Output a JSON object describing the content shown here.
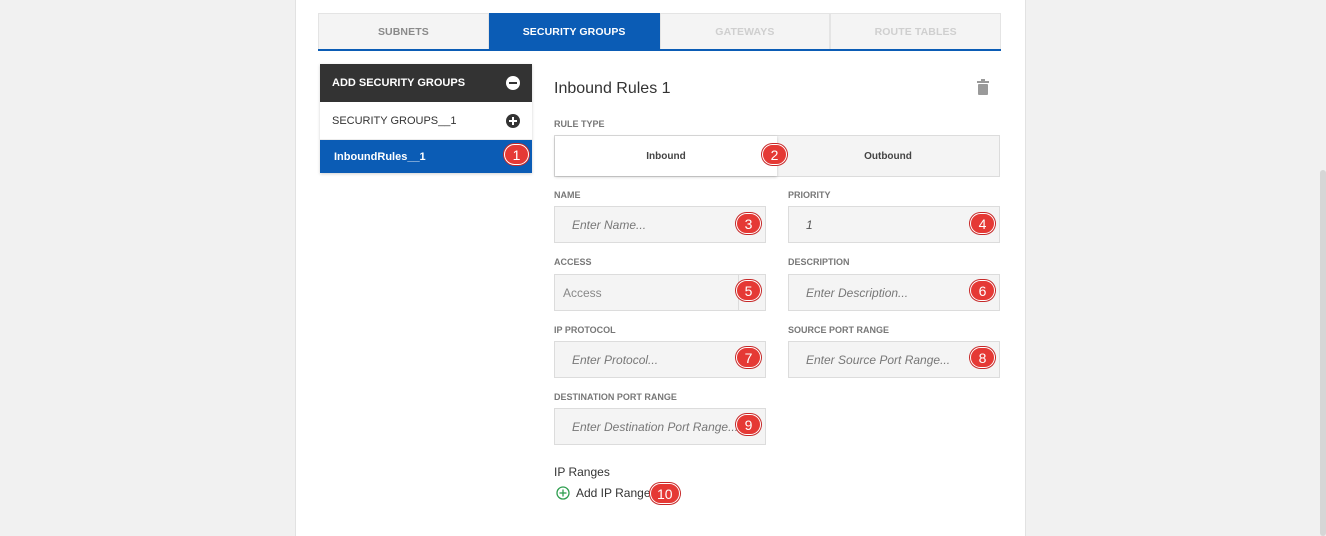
{
  "tabs": [
    {
      "label": "SUBNETS",
      "state": "normal"
    },
    {
      "label": "SECURITY GROUPS",
      "state": "active"
    },
    {
      "label": "GATEWAYS",
      "state": "disabled"
    },
    {
      "label": "ROUTE TABLES",
      "state": "disabled"
    }
  ],
  "sidebar": {
    "header_label": "ADD SECURITY GROUPS",
    "items": [
      {
        "label": "SECURITY GROUPS__1"
      },
      {
        "label": "InboundRules__1"
      }
    ]
  },
  "form": {
    "title": "Inbound Rules 1",
    "rule_type_label": "RULE TYPE",
    "rule_type_options": [
      "Inbound",
      "Outbound"
    ],
    "rule_type_selected": "Inbound",
    "name_label": "NAME",
    "name_placeholder": "Enter Name...",
    "priority_label": "PRIORITY",
    "priority_value": "1",
    "access_label": "ACCESS",
    "access_value": "Access",
    "description_label": "DESCRIPTION",
    "description_placeholder": "Enter Description...",
    "ip_protocol_label": "IP PROTOCOL",
    "ip_protocol_placeholder": "Enter Protocol...",
    "source_port_label": "SOURCE PORT RANGE",
    "source_port_placeholder": "Enter Source Port Range...",
    "dest_port_label": "DESTINATION PORT RANGE",
    "dest_port_placeholder": "Enter Destination Port Range...",
    "ip_ranges_label": "IP Ranges",
    "add_ip_ranges_label": "Add IP Ranges"
  },
  "badges": [
    "1",
    "2",
    "3",
    "4",
    "5",
    "6",
    "7",
    "8",
    "9",
    "10"
  ],
  "icons": {
    "add_group": "minus-circle-icon",
    "group_item": "plus-circle-icon",
    "delete": "trash-icon",
    "add_ip": "plus-circle-outline-icon"
  },
  "colors": {
    "accent": "#0b5cb5",
    "dark_header": "#333333",
    "badge": "#e53935",
    "add_green": "#2e9e4f"
  }
}
